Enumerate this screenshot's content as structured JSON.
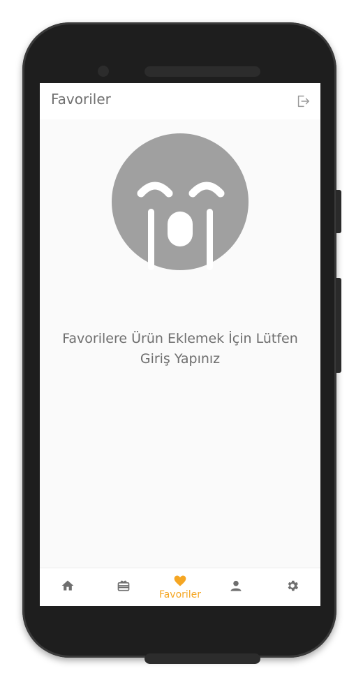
{
  "appbar": {
    "title": "Favoriler",
    "action_icon": "logout-icon"
  },
  "empty_state": {
    "icon": "crying-face-icon",
    "message": "Favorilere Ürün Eklemek İçin Lütfen Giriş Yapınız"
  },
  "bottom_nav": {
    "items": [
      {
        "icon": "home-icon",
        "label": ""
      },
      {
        "icon": "gift-card-icon",
        "label": ""
      },
      {
        "icon": "heart-icon",
        "label": "Favoriler",
        "active": true
      },
      {
        "icon": "person-icon",
        "label": ""
      },
      {
        "icon": "gear-icon",
        "label": ""
      }
    ]
  },
  "colors": {
    "accent": "#F5A623",
    "icon_gray": "#6E6E6E",
    "face_gray": "#A0A0A0",
    "screen_bg": "#FAFAFA"
  }
}
